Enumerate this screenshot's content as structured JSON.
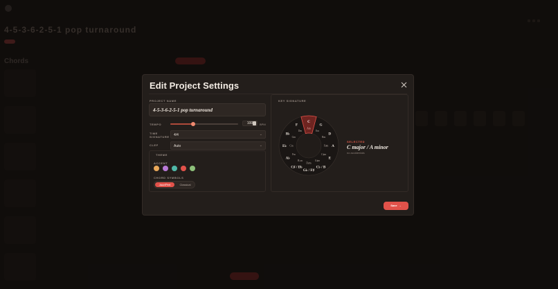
{
  "modal": {
    "title": "Edit Project Settings",
    "close_icon": "close-icon",
    "project_name_label": "PROJECT NAME",
    "project_name_value": "4-5-3-6-2-5-1 pop turnaround",
    "tempo_label": "TEMPO",
    "tempo_value": "100",
    "tempo_fraction": 0.34,
    "tempo_unit": "BPM",
    "time_signature_label": "TIME SIGNATURE",
    "time_signature_value": "4/4",
    "clef_label": "CLEF",
    "clef_value": "Auto",
    "theme_label": "THEME",
    "accent_label": "ACCENT",
    "accent_colors": [
      "#e8a85a",
      "#b87ad6",
      "#4fb8a8",
      "#e2524a",
      "#8dc07a"
    ],
    "chord_symbols_label": "CHORD SYMBOLS",
    "chord_symbols_options": [
      "Jazz/Pert",
      "Classical"
    ],
    "chord_symbols_selected": "Jazz/Pert",
    "key_signature_label": "KEY SIGNATURE",
    "selected_label": "SELECTED",
    "selected_key": "C major / A minor",
    "accidentals": "no accidentals",
    "save_label": "Save",
    "save_icon": "arrow-right-icon"
  },
  "circle_of_fifths": {
    "major": [
      "C",
      "G",
      "D",
      "A",
      "E",
      "C♭ / B",
      "G♭ / F♯",
      "C♯ / D♭",
      "A♭",
      "E♭",
      "B♭",
      "F"
    ],
    "minor": [
      "Am",
      "Em",
      "Bm",
      "F♯m",
      "C♯m",
      "G♯m",
      "D♯m",
      "B♭m",
      "Fm",
      "Cm",
      "Gm",
      "Dm"
    ],
    "selected_index": 0,
    "accent": "#e2524a"
  },
  "background": {
    "section_title": "4-5-3-6-2-5-1 pop turnaround",
    "section_label": "Chords"
  }
}
